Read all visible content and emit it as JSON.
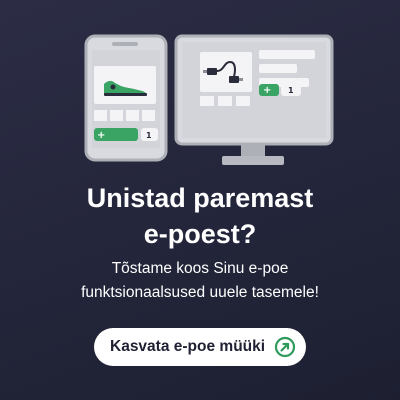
{
  "hero": {
    "headline_line1": "Unistad paremast",
    "headline_line2": "e-poest?",
    "subtext_line1": "Tõstame koos Sinu e-poe",
    "subtext_line2": "funktsionaalsused uuele tasemele!"
  },
  "cta": {
    "label": "Kasvata e-poe müüki",
    "icon": "arrow-up-right-icon",
    "icon_color": "#2e9a5c"
  },
  "illustration": {
    "phone_quantity": "1",
    "monitor_quantity": "1",
    "phone_product": "green-sneaker-icon",
    "monitor_product": "usb-cable-icon",
    "accent_color": "#3aa464"
  }
}
